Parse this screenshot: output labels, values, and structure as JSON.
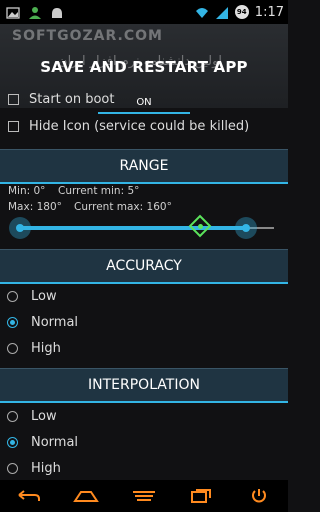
{
  "status_bar": {
    "time": "1:17",
    "battery": "94",
    "left_icons": [
      "image-icon",
      "user-icon",
      "android-icon"
    ],
    "right_icons": [
      "wifi-icon",
      "signal-icon",
      "battery-icon"
    ]
  },
  "header": {
    "watermark": "SOFTGOZAR.COM",
    "title": "SAVE AND RESTART APP",
    "persian_text": "اولین دانشنامه نرم افزار ایران",
    "tab_label": "ON"
  },
  "options": {
    "start_on_boot": "Start on boot",
    "hide_icon": "Hide Icon (service could be killed)"
  },
  "range": {
    "title": "RANGE",
    "min": "Min: 0°",
    "current_min": "Current min: 5°",
    "max": "Max: 180°",
    "current_max": "Current max: 160°"
  },
  "accuracy": {
    "title": "ACCURACY",
    "options": [
      "Low",
      "Normal",
      "High"
    ],
    "selected": "Normal"
  },
  "interpolation": {
    "title": "INTERPOLATION",
    "options": [
      "Low",
      "Normal",
      "High"
    ],
    "selected": "Normal"
  },
  "colors": {
    "accent": "#33b5e5",
    "marker": "#5be35b",
    "nav_icon": "#ff8a1f"
  },
  "nav": [
    "back-icon",
    "home-icon",
    "recents-icon",
    "multiwindow-icon",
    "power-icon"
  ]
}
